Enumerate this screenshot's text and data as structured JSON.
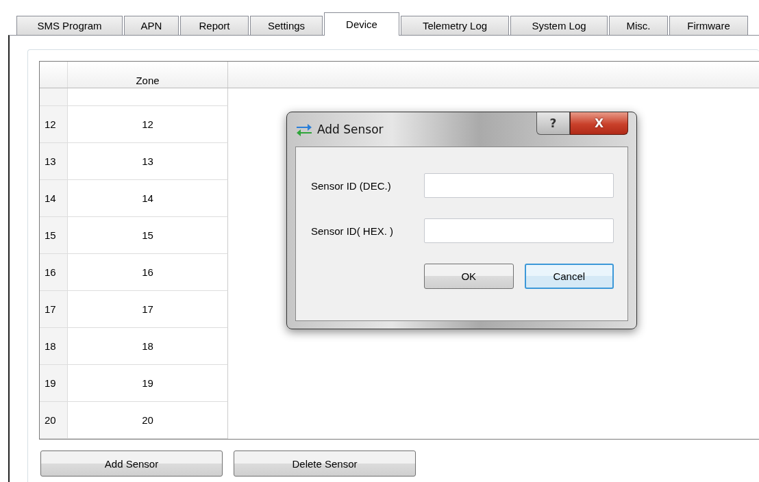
{
  "tabs": [
    {
      "label": "SMS Program",
      "selected": false
    },
    {
      "label": "APN",
      "selected": false
    },
    {
      "label": "Report",
      "selected": false
    },
    {
      "label": "Settings",
      "selected": false
    },
    {
      "label": "Device",
      "selected": true
    },
    {
      "label": "Telemetry Log",
      "selected": false
    },
    {
      "label": "System Log",
      "selected": false
    },
    {
      "label": "Misc.",
      "selected": false
    },
    {
      "label": "Firmware",
      "selected": false
    }
  ],
  "table": {
    "columns": [
      "Zone"
    ],
    "rows": [
      {
        "row_header": "12",
        "zone": "12"
      },
      {
        "row_header": "13",
        "zone": "13"
      },
      {
        "row_header": "14",
        "zone": "14"
      },
      {
        "row_header": "15",
        "zone": "15"
      },
      {
        "row_header": "16",
        "zone": "16"
      },
      {
        "row_header": "17",
        "zone": "17"
      },
      {
        "row_header": "18",
        "zone": "18"
      },
      {
        "row_header": "19",
        "zone": "19"
      },
      {
        "row_header": "20",
        "zone": "20"
      }
    ]
  },
  "buttons": [
    "Add Sensor",
    "Delete Sensor"
  ],
  "dialog": {
    "title": "Add Sensor",
    "help_button": "?",
    "close_button": "X",
    "fields": [
      {
        "label": "Sensor ID (DEC.)"
      },
      {
        "label": "Sensor ID( HEX. )"
      }
    ],
    "buttons": [
      {
        "label": "OK",
        "selected": false
      },
      {
        "label": "Cancel",
        "selected": true
      }
    ]
  }
}
